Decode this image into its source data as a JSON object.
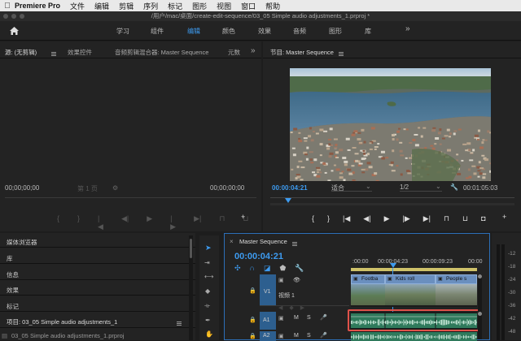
{
  "menubar": {
    "app_name": "Premiere Pro",
    "items": [
      "文件",
      "编辑",
      "剪辑",
      "序列",
      "标记",
      "图形",
      "视图",
      "窗口",
      "帮助"
    ]
  },
  "window_title": "/用户/mac/桌面/create-edit-sequence/03_05 Simple audio adjustments_1.prproj *",
  "workspaces": {
    "items": [
      "学习",
      "组件",
      "编辑",
      "颜色",
      "效果",
      "音频",
      "图形",
      "库"
    ],
    "active": "编辑",
    "more": "»"
  },
  "source_panel": {
    "tabs": [
      "源: (无剪辑)",
      "效果控件",
      "音频剪辑混合器: Master Sequence",
      "元数"
    ],
    "more": "»",
    "timecode_left": "00;00;00;00",
    "page_label": "第 1 页",
    "timecode_right": "00;00;00;00"
  },
  "program_panel": {
    "tab": "节目: Master Sequence",
    "timecode_current": "00:00:04:21",
    "fit_select": "适合",
    "resolution_select": "1/2",
    "timecode_duration": "00:01:05:03"
  },
  "project_panel": {
    "tabs": [
      "媒体浏览器",
      "库",
      "信息",
      "效果",
      "标记"
    ],
    "project_label": "项目: 03_05 Simple audio adjustments_1",
    "file_name": "03_05 Simple audio adjustments_1.prproj"
  },
  "timeline": {
    "tab": "Master Sequence",
    "timecode": "00:00:04:21",
    "ruler_labels": [
      ":00:00",
      "00:00:04:23",
      "00:00:09:23",
      "00:00"
    ],
    "tracks": {
      "v1": {
        "label": "V1",
        "name": "视频 1"
      },
      "a1": {
        "label": "A1"
      },
      "a2": {
        "label": "A2"
      }
    },
    "clips": [
      "Footba",
      "Kids roll",
      "People s"
    ],
    "meter_labels": [
      "-12",
      "-18",
      "-24",
      "-30",
      "-36",
      "-42",
      "-48"
    ]
  },
  "colors": {
    "accent_blue": "#3d9bf0",
    "video_clip": "#6a8fbf",
    "audio_clip": "#2f7a5c",
    "highlight_box": "#e0524a"
  }
}
